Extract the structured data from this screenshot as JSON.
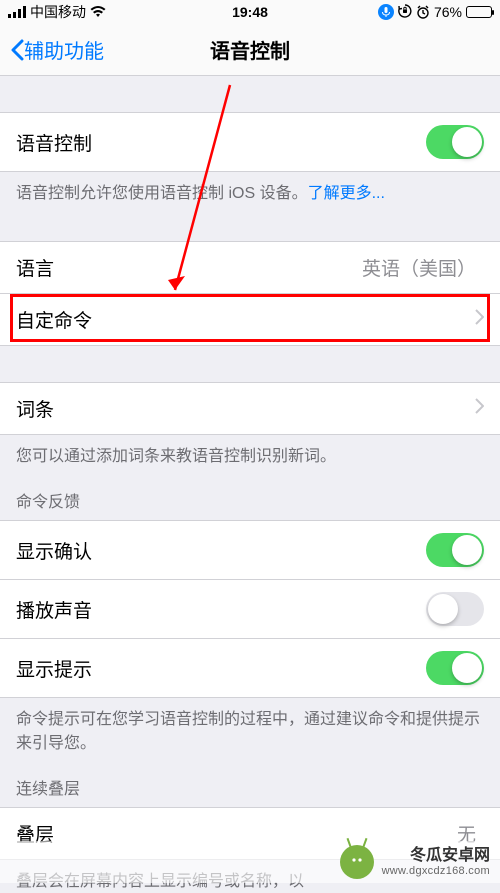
{
  "status": {
    "carrier": "中国移动",
    "time": "19:48",
    "battery_pct": "76%"
  },
  "nav": {
    "back_label": "辅助功能",
    "title": "语音控制"
  },
  "voice_group": {
    "label": "语音控制",
    "enabled": true,
    "footer": "语音控制允许您使用语音控制 iOS 设备。",
    "learn_more": "了解更多..."
  },
  "config_group": {
    "language_label": "语言",
    "language_value": "英语（美国）",
    "custom_commands_label": "自定命令"
  },
  "vocab_group": {
    "label": "词条",
    "footer": "您可以通过添加词条来教语音控制识别新词。"
  },
  "feedback_group": {
    "header": "命令反馈",
    "show_confirm_label": "显示确认",
    "show_confirm_on": true,
    "play_sound_label": "播放声音",
    "play_sound_on": false,
    "show_hints_label": "显示提示",
    "show_hints_on": true,
    "footer": "命令提示可在您学习语音控制的过程中，通过建议命令和提供提示来引导您。"
  },
  "overlay_group": {
    "header": "连续叠层",
    "overlay_label": "叠层",
    "overlay_value": "无",
    "footer": "叠层会在屏幕内容上显示编号或名称，以"
  },
  "watermark": {
    "name": "冬瓜安卓网",
    "url": "www.dgxcdz168.com"
  }
}
